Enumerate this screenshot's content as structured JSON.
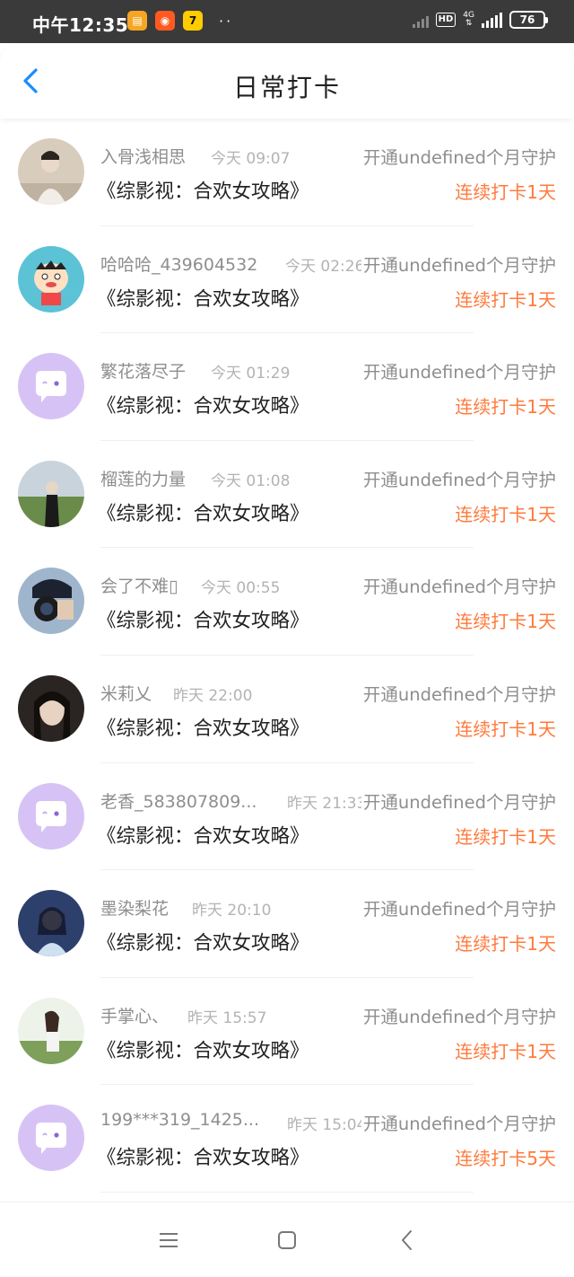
{
  "status_bar": {
    "time": "中午12:35",
    "dots": "··",
    "hd": "HD",
    "network": "4G",
    "battery": "76"
  },
  "header": {
    "title": "日常打卡",
    "back_icon": "chevron-left-icon"
  },
  "checkins": [
    {
      "user": "入骨浅相思",
      "time": "今天 09:07",
      "guard": "开通undefined个月守护",
      "novel": "《综影视：合欢女攻略》",
      "streak": "连续打卡1天",
      "avatar": "photo-ancient-costume"
    },
    {
      "user": "哈哈哈_439604532",
      "time": "今天 02:26",
      "guard": "开通undefined个月守护",
      "novel": "《综影视：合欢女攻略》",
      "streak": "连续打卡1天",
      "avatar": "cartoon-boy"
    },
    {
      "user": "繁花落尽子",
      "time": "今天 01:29",
      "guard": "开通undefined个月守护",
      "novel": "《综影视：合欢女攻略》",
      "streak": "连续打卡1天",
      "avatar": "default-chat-bubble"
    },
    {
      "user": "榴莲的力量",
      "time": "今天 01:08",
      "guard": "开通undefined个月守护",
      "novel": "《综影视：合欢女攻略》",
      "streak": "连续打卡1天",
      "avatar": "photo-field"
    },
    {
      "user": "会了不难▯",
      "time": "今天 00:55",
      "guard": "开通undefined个月守护",
      "novel": "《综影视：合欢女攻略》",
      "streak": "连续打卡1天",
      "avatar": "photo-camera"
    },
    {
      "user": "米莉乂",
      "time": "昨天 22:00",
      "guard": "开通undefined个月守护",
      "novel": "《综影视：合欢女攻略》",
      "streak": "连续打卡1天",
      "avatar": "photo-portrait"
    },
    {
      "user": "老香_583807809...",
      "time": "昨天 21:33",
      "guard": "开通undefined个月守护",
      "novel": "《综影视：合欢女攻略》",
      "streak": "连续打卡1天",
      "avatar": "default-chat-bubble"
    },
    {
      "user": "墨染梨花",
      "time": "昨天 20:10",
      "guard": "开通undefined个月守护",
      "novel": "《综影视：合欢女攻略》",
      "streak": "连续打卡1天",
      "avatar": "photo-blue-portrait"
    },
    {
      "user": "手掌心、",
      "time": "昨天 15:57",
      "guard": "开通undefined个月守护",
      "novel": "《综影视：合欢女攻略》",
      "streak": "连续打卡1天",
      "avatar": "photo-outdoor"
    },
    {
      "user": "199***319_1425...",
      "time": "昨天 15:04",
      "guard": "开通undefined个月守护",
      "novel": "《综影视：合欢女攻略》",
      "streak": "连续打卡5天",
      "avatar": "default-chat-bubble"
    }
  ],
  "nav": {
    "menu_icon": "menu-icon",
    "home_icon": "home-square-icon",
    "back_icon": "back-triangle-icon"
  },
  "colors": {
    "accent_blue": "#1a8cff",
    "streak_orange": "#ff7a3c",
    "default_avatar_purple": "#d7c2f5"
  }
}
